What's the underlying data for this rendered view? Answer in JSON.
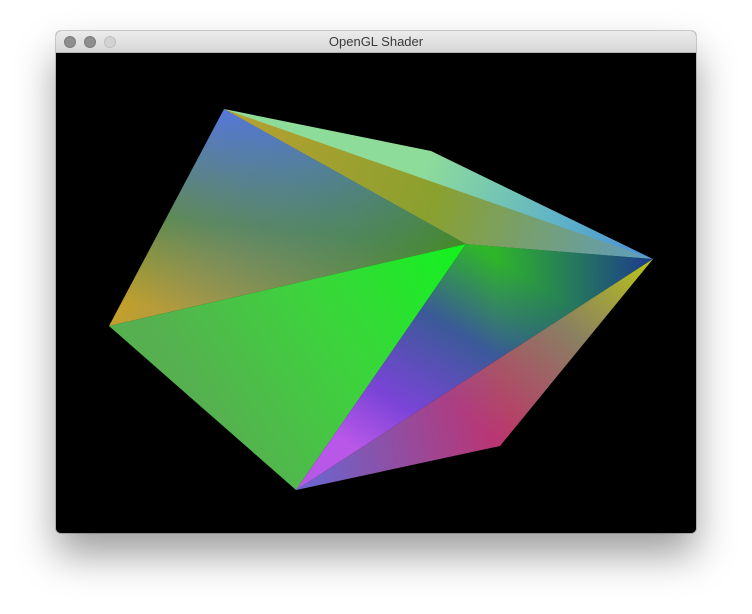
{
  "window": {
    "title": "OpenGL Shader",
    "controls": [
      "close-button",
      "minimize-button",
      "zoom-button"
    ]
  },
  "viewport": {
    "background_color": "#000000"
  }
}
